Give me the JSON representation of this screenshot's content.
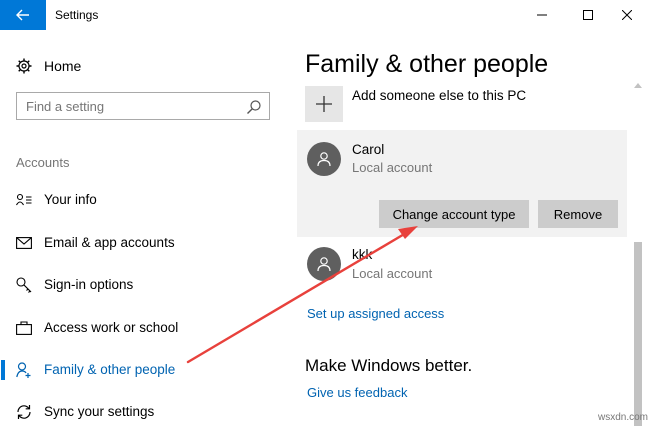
{
  "window": {
    "title": "Settings",
    "accent_color": "#0078d7",
    "controls": {
      "minimize": "minimize-icon",
      "maximize": "maximize-icon",
      "close": "close-icon"
    }
  },
  "sidebar": {
    "home_label": "Home",
    "search_placeholder": "Find a setting",
    "section_label": "Accounts",
    "items": [
      {
        "label": "Your info",
        "icon": "contact-card-icon",
        "selected": false
      },
      {
        "label": "Email & app accounts",
        "icon": "mail-icon",
        "selected": false
      },
      {
        "label": "Sign-in options",
        "icon": "key-icon",
        "selected": false
      },
      {
        "label": "Access work or school",
        "icon": "briefcase-icon",
        "selected": false
      },
      {
        "label": "Family & other people",
        "icon": "person-add-icon",
        "selected": true
      },
      {
        "label": "Sync your settings",
        "icon": "sync-icon",
        "selected": false
      }
    ]
  },
  "main": {
    "title": "Family & other people",
    "add_someone_label": "Add someone else to this PC",
    "accounts": [
      {
        "name": "Carol",
        "type": "Local account",
        "expanded": true
      },
      {
        "name": "kkk",
        "type": "Local account",
        "expanded": false
      }
    ],
    "buttons": {
      "change_type": "Change account type",
      "remove": "Remove"
    },
    "assigned_access_link": "Set up assigned access",
    "make_better_heading": "Make Windows better.",
    "feedback_link": "Give us feedback"
  },
  "annotation": {
    "arrow_color": "#e8413c"
  },
  "watermark": "wsxdn.com"
}
